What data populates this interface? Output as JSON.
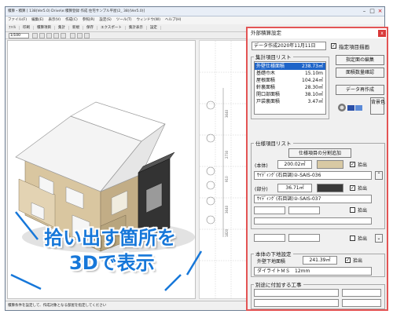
{
  "app": {
    "title": "積算・積算 [ 138(Ver5.0) Drive\\e:積算登録 作成 住宅サンプル平屋(2_ 38)(Ver5.0)]",
    "menu": [
      "ファイル(F)",
      "編集(E)",
      "表示(V)",
      "作成(C)",
      "参照(R)",
      "設定(S)",
      "ツール(T)",
      "ウィンドウ(W)",
      "ヘルプ(H)"
    ],
    "toolbar": [
      "ﾌｧｲﾙ",
      "印刷",
      "積算項目",
      "集計",
      "新規",
      "保存",
      "エクスポート",
      "集計表示",
      "設定"
    ],
    "scale_select": "1/100",
    "status_text": "積算条件を設定して、作成対象となる部屋を指定してください"
  },
  "callout": {
    "line1": "拾い出す箇所を",
    "line2": "3Dで表示",
    "color": "#1677d9"
  },
  "dialog": {
    "title": "外部積算設定",
    "close": "x",
    "created_date": "データ作成2020年11月11日",
    "buttons": {
      "draw_selected": "指定項目描画",
      "edit_surface": "指定面の編集",
      "confirm_area": "面積数量確認",
      "regen": "データ再作成",
      "bg_color": "背景色"
    },
    "summary": {
      "label": "集計項目リスト",
      "rows": [
        {
          "name": "外壁仕様面積",
          "value": "238.73㎡",
          "selected": true
        },
        {
          "name": "基礎巾木",
          "value": "15.10m",
          "selected": false
        },
        {
          "name": "屋根面積",
          "value": "104.24㎡",
          "selected": false
        },
        {
          "name": "軒裏面積",
          "value": "28.30㎡",
          "selected": false
        },
        {
          "name": "開口部面積",
          "value": "38.10㎡",
          "selected": false
        },
        {
          "name": "戸袋裏面積",
          "value": "3.47㎡",
          "selected": false
        }
      ]
    },
    "spec": {
      "label": "仕様項目リスト",
      "split_button": "仕様項目の分割追加",
      "main_label": "(本体)",
      "main_value": "200.02㎡",
      "main_check": "拾出",
      "main_spec": "ｻｲﾃﾞｨﾝｸﾞ(石目調)②-SAIS-036",
      "part_label": "(部分)",
      "part_value": "36.71㎡",
      "part_check": "拾出",
      "part_spec": "ｻｲﾃﾞｨﾝｸﾞ(石目調)②-SAIS-037",
      "empty_check_1": "拾出",
      "empty_check_2": "拾出",
      "main_swatch": "#d8c9a4",
      "part_swatch": "#3a3a3a"
    },
    "base": {
      "label": "本体の下地設定",
      "name": "外壁下地面積",
      "value": "241.39㎡",
      "check": "拾出",
      "material": "ダイライトＭＳ　12mm"
    },
    "extra": {
      "label": "別途に付加する工事"
    }
  },
  "plan": {
    "dimensions": [
      "3640",
      "2730",
      "910",
      "3640",
      "1820"
    ]
  }
}
